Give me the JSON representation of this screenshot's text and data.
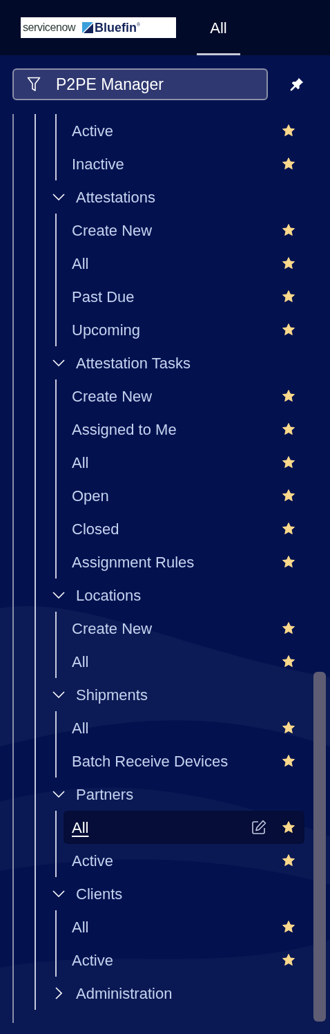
{
  "header": {
    "logo": {
      "primary": "servicenow",
      "secondary": "Bluefin",
      "mark": "®"
    },
    "tabs": [
      {
        "label": "All",
        "selected": true
      }
    ]
  },
  "filter": {
    "value": "P2PE Manager"
  },
  "sections": [
    {
      "items": [
        {
          "label": "Active",
          "favorite": true,
          "selected": false
        },
        {
          "label": "Inactive",
          "favorite": true,
          "selected": false
        }
      ]
    },
    {
      "label": "Attestations",
      "expanded": true,
      "items": [
        {
          "label": "Create New",
          "favorite": true,
          "selected": false
        },
        {
          "label": "All",
          "favorite": true,
          "selected": false
        },
        {
          "label": "Past Due",
          "favorite": true,
          "selected": false
        },
        {
          "label": "Upcoming",
          "favorite": true,
          "selected": false
        }
      ]
    },
    {
      "label": "Attestation Tasks",
      "expanded": true,
      "items": [
        {
          "label": "Create New",
          "favorite": true,
          "selected": false
        },
        {
          "label": "Assigned to Me",
          "favorite": true,
          "selected": false
        },
        {
          "label": "All",
          "favorite": true,
          "selected": false
        },
        {
          "label": "Open",
          "favorite": true,
          "selected": false
        },
        {
          "label": "Closed",
          "favorite": true,
          "selected": false
        },
        {
          "label": "Assignment Rules",
          "favorite": true,
          "selected": false
        }
      ]
    },
    {
      "label": "Locations",
      "expanded": true,
      "items": [
        {
          "label": "Create New",
          "favorite": true,
          "selected": false
        },
        {
          "label": "All",
          "favorite": true,
          "selected": false
        }
      ]
    },
    {
      "label": "Shipments",
      "expanded": true,
      "items": [
        {
          "label": "All",
          "favorite": true,
          "selected": false
        },
        {
          "label": "Batch Receive Devices",
          "favorite": true,
          "selected": false
        }
      ]
    },
    {
      "label": "Partners",
      "expanded": true,
      "items": [
        {
          "label": "All",
          "favorite": true,
          "selected": true
        },
        {
          "label": "Active",
          "favorite": true,
          "selected": false
        }
      ]
    },
    {
      "label": "Clients",
      "expanded": true,
      "items": [
        {
          "label": "All",
          "favorite": true,
          "selected": false
        },
        {
          "label": "Active",
          "favorite": true,
          "selected": false
        }
      ]
    },
    {
      "label": "Administration",
      "expanded": false
    }
  ]
}
